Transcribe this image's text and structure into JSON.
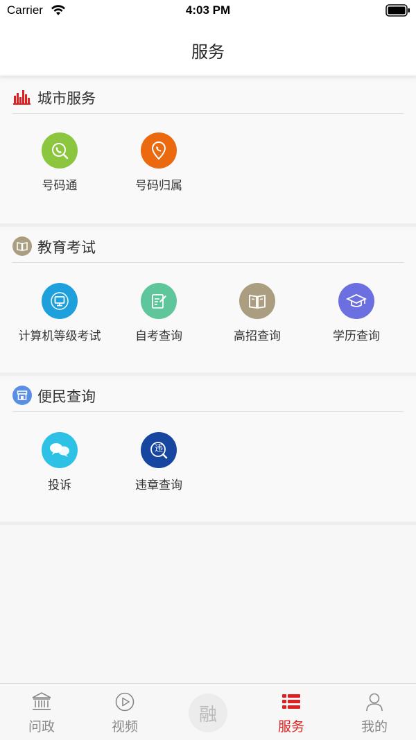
{
  "status_bar": {
    "carrier": "Carrier",
    "time": "4:03 PM"
  },
  "nav": {
    "title": "服务"
  },
  "sections": [
    {
      "title": "城市服务",
      "items": [
        {
          "label": "号码通",
          "color": "#8cc63e",
          "icon": "phone-search-icon"
        },
        {
          "label": "号码归属",
          "color": "#ec6a0f",
          "icon": "phone-location-icon"
        }
      ]
    },
    {
      "title": "教育考试",
      "items": [
        {
          "label": "计算机等级考试",
          "color": "#1ea0dc",
          "icon": "computer-icon"
        },
        {
          "label": "自考查询",
          "color": "#5fc59b",
          "icon": "edit-note-icon"
        },
        {
          "label": "高招查询",
          "color": "#ab9d7f",
          "icon": "book-icon"
        },
        {
          "label": "学历查询",
          "color": "#6b6fe0",
          "icon": "graduation-cap-icon"
        }
      ]
    },
    {
      "title": "便民查询",
      "items": [
        {
          "label": "投诉",
          "color": "#2ec1e6",
          "icon": "chat-bubbles-icon"
        },
        {
          "label": "违章查询",
          "color": "#1646a0",
          "icon": "violation-search-icon",
          "glyph": "违"
        }
      ]
    }
  ],
  "tabs": [
    {
      "label": "问政",
      "icon": "government-building-icon",
      "active": false
    },
    {
      "label": "视频",
      "icon": "play-circle-icon",
      "active": false
    },
    {
      "label": "融",
      "icon": "center-badge-icon",
      "active": false
    },
    {
      "label": "服务",
      "icon": "list-icon",
      "active": true
    },
    {
      "label": "我的",
      "icon": "person-icon",
      "active": false
    }
  ],
  "colors": {
    "accent": "#e02020",
    "section_icon_red": "#e02020"
  }
}
